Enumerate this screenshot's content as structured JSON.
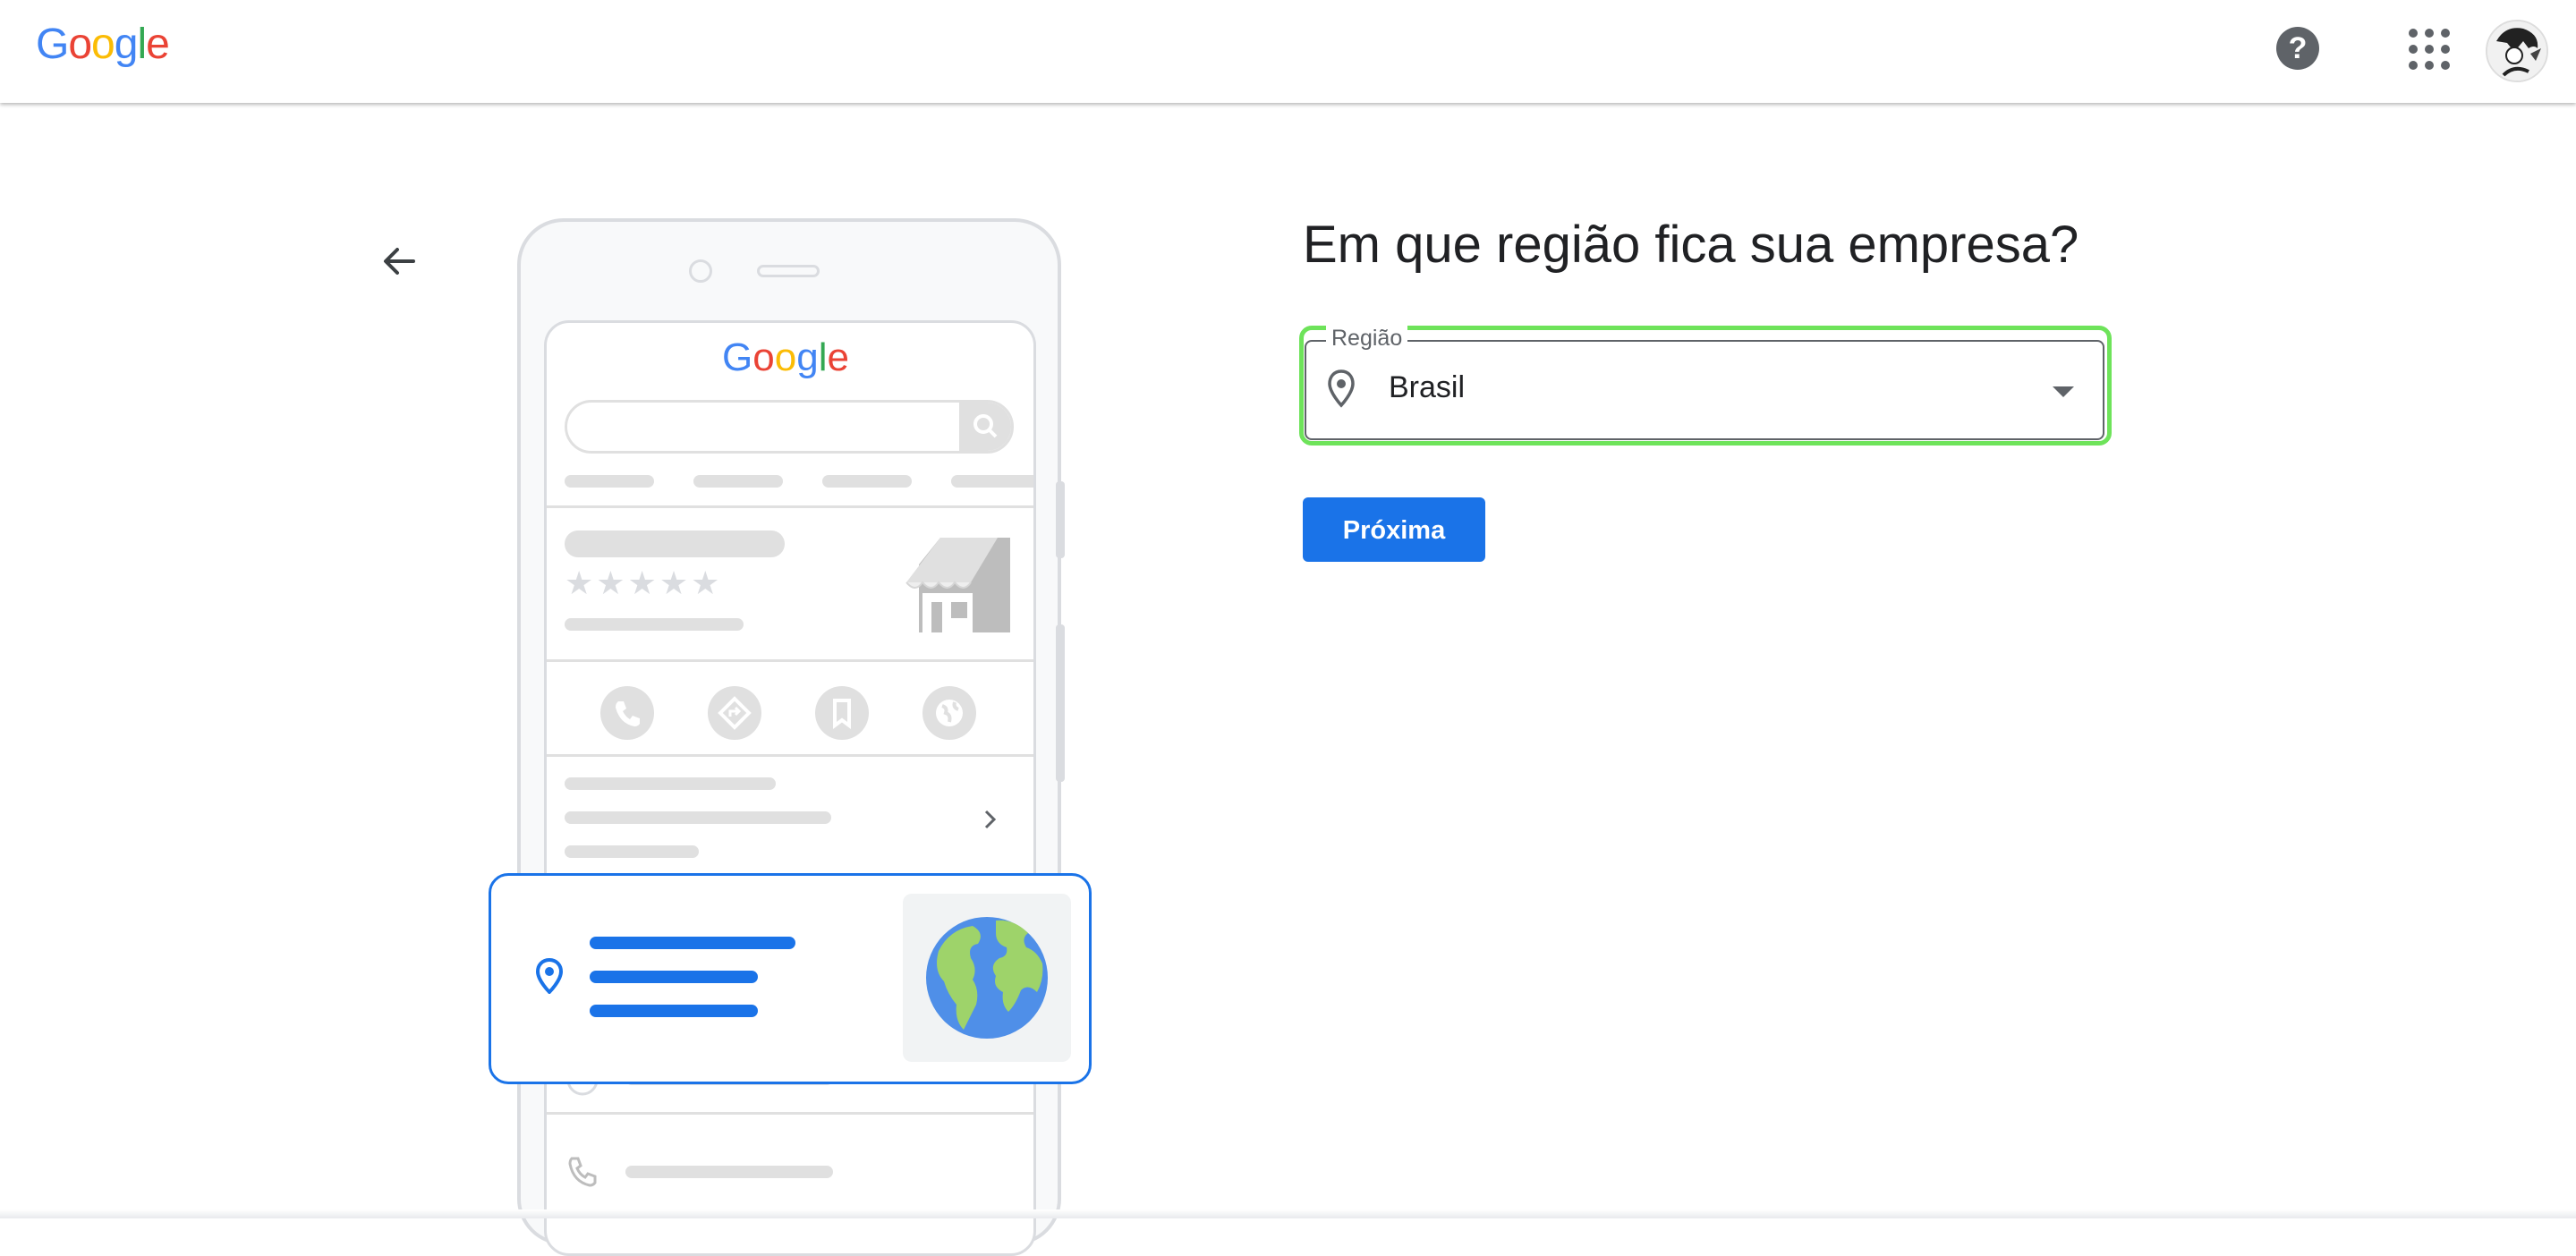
{
  "header": {
    "logo_text": [
      "G",
      "o",
      "o",
      "g",
      "l",
      "e"
    ],
    "help_icon": "help-circle-icon",
    "apps_icon": "apps-grid-icon",
    "avatar_icon": "user-avatar"
  },
  "illustration": {
    "phone_logo": [
      "G",
      "o",
      "o",
      "g",
      "l",
      "e"
    ],
    "rating_stars": "★★★★★",
    "action_icons": [
      "phone-icon",
      "directions-icon",
      "bookmark-icon",
      "globe-icon"
    ]
  },
  "main": {
    "title": "Em que região fica sua empresa?",
    "region_field": {
      "label": "Região",
      "value": "Brasil",
      "icon": "location-pin-icon"
    },
    "next_button_label": "Próxima"
  },
  "colors": {
    "accent": "#1a73e8",
    "focus_ring": "#6ee35a",
    "icon_gray": "#5f6368"
  }
}
